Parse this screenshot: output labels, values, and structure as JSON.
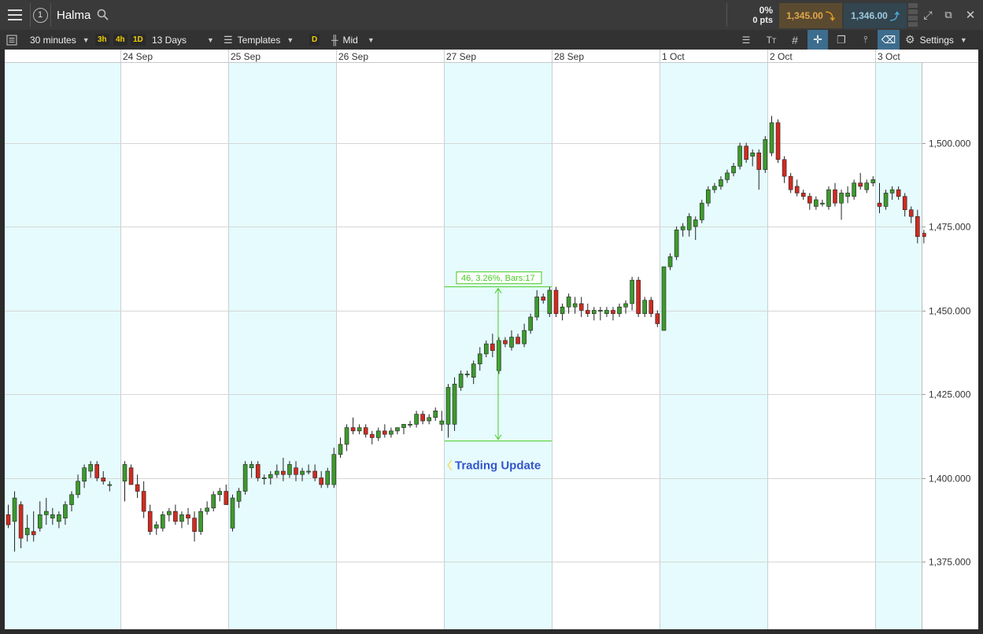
{
  "header": {
    "symbol": "Halma",
    "watchlist_number": "1",
    "change_pct": "0%",
    "change_pts": "0 pts",
    "sell_price": "1,345.00",
    "buy_price": "1,346.00"
  },
  "toolbar": {
    "interval": "30 minutes",
    "quick_intervals": [
      "3h",
      "4h",
      "1D"
    ],
    "range": "13 Days",
    "templates": "Templates",
    "price_type_badge": "D",
    "price_type": "Mid",
    "settings": "Settings"
  },
  "chart_data": {
    "type": "candlestick",
    "instrument": "Halma",
    "interval": "30 minutes",
    "x_labels": [
      "24 Sep",
      "25 Sep",
      "26 Sep",
      "27 Sep",
      "28 Sep",
      "1 Oct",
      "2 Oct",
      "3 Oct"
    ],
    "y_ticks": [
      "1,375.000",
      "1,400.000",
      "1,425.000",
      "1,450.000",
      "1,475.000",
      "1,500.000"
    ],
    "ylim": [
      1356.2,
      1522.5
    ],
    "grid": true,
    "up_color": "#3d9a2e",
    "down_color": "#d02b20",
    "day_shading_color": "#e6fbfd",
    "days": [
      {
        "label": "",
        "shaded": true,
        "candles": [
          [
            1389,
            1392,
            1385,
            1386
          ],
          [
            1387,
            1396,
            1378,
            1394
          ],
          [
            1392,
            1393,
            1379,
            1382
          ],
          [
            1383,
            1389,
            1381,
            1385
          ],
          [
            1384,
            1390,
            1381,
            1383
          ],
          [
            1385,
            1393,
            1384,
            1389
          ],
          [
            1389,
            1394,
            1386,
            1390
          ],
          [
            1388,
            1391,
            1386,
            1389
          ],
          [
            1387,
            1390,
            1385,
            1389
          ],
          [
            1388,
            1393,
            1386,
            1392
          ],
          [
            1392,
            1396,
            1390,
            1395
          ],
          [
            1395,
            1401,
            1394,
            1399
          ],
          [
            1399,
            1404,
            1397,
            1403
          ],
          [
            1402,
            1405,
            1400,
            1404
          ],
          [
            1404,
            1405,
            1399,
            1400
          ],
          [
            1400,
            1402,
            1398,
            1399
          ],
          [
            1398,
            1399,
            1396,
            1398
          ]
        ]
      },
      {
        "label": "24 Sep",
        "shaded": false,
        "candles": [
          [
            1399,
            1405,
            1393,
            1404
          ],
          [
            1403,
            1404,
            1398,
            1398
          ],
          [
            1398,
            1401,
            1394,
            1396
          ],
          [
            1396,
            1399,
            1388,
            1390
          ],
          [
            1390,
            1392,
            1383,
            1384
          ],
          [
            1385,
            1387,
            1383,
            1386
          ],
          [
            1385,
            1390,
            1384,
            1389
          ],
          [
            1389,
            1391,
            1387,
            1390
          ],
          [
            1390,
            1392,
            1386,
            1387
          ],
          [
            1387,
            1390,
            1385,
            1389
          ],
          [
            1389,
            1391,
            1386,
            1388
          ],
          [
            1388,
            1390,
            1381,
            1384
          ],
          [
            1384,
            1391,
            1383,
            1390
          ],
          [
            1390,
            1393,
            1389,
            1391
          ],
          [
            1391,
            1396,
            1390,
            1395
          ],
          [
            1395,
            1397,
            1393,
            1396
          ],
          [
            1396,
            1398,
            1392,
            1392
          ]
        ]
      },
      {
        "label": "25 Sep",
        "shaded": true,
        "candles": [
          [
            1385,
            1395,
            1384,
            1394
          ],
          [
            1393,
            1397,
            1391,
            1396
          ],
          [
            1396,
            1405,
            1395,
            1404
          ],
          [
            1403,
            1405,
            1400,
            1404
          ],
          [
            1404,
            1405,
            1399,
            1400
          ],
          [
            1400,
            1401,
            1398,
            1400
          ],
          [
            1400,
            1402,
            1398,
            1401
          ],
          [
            1401,
            1404,
            1400,
            1402
          ],
          [
            1402,
            1406,
            1399,
            1401
          ],
          [
            1401,
            1405,
            1400,
            1404
          ],
          [
            1403,
            1405,
            1399,
            1401
          ],
          [
            1401,
            1403,
            1399,
            1402
          ],
          [
            1402,
            1404,
            1401,
            1402
          ],
          [
            1402,
            1404,
            1399,
            1400
          ],
          [
            1400,
            1402,
            1397,
            1398
          ],
          [
            1398,
            1403,
            1397,
            1402
          ],
          [
            1398,
            1409,
            1397,
            1407
          ]
        ]
      },
      {
        "label": "26 Sep",
        "shaded": false,
        "candles": [
          [
            1407,
            1412,
            1406,
            1410
          ],
          [
            1410,
            1416,
            1408,
            1415
          ],
          [
            1415,
            1418,
            1413,
            1414
          ],
          [
            1414,
            1416,
            1413,
            1415
          ],
          [
            1415,
            1416,
            1412,
            1413
          ],
          [
            1413,
            1414,
            1410,
            1412
          ],
          [
            1412,
            1415,
            1411,
            1414
          ],
          [
            1414,
            1416,
            1412,
            1413
          ],
          [
            1413,
            1415,
            1412,
            1414
          ],
          [
            1414,
            1415,
            1413,
            1415
          ],
          [
            1415,
            1416,
            1413,
            1416
          ],
          [
            1416,
            1417,
            1415,
            1416
          ],
          [
            1416,
            1420,
            1415,
            1419
          ],
          [
            1419,
            1420,
            1416,
            1417
          ],
          [
            1417,
            1419,
            1416,
            1418
          ],
          [
            1418,
            1421,
            1417,
            1420
          ],
          [
            1416,
            1420,
            1414,
            1417
          ]
        ]
      },
      {
        "label": "27 Sep",
        "shaded": true,
        "candles": [
          [
            1416,
            1428,
            1412,
            1427
          ],
          [
            1416,
            1430,
            1414,
            1428
          ],
          [
            1427,
            1432,
            1426,
            1431
          ],
          [
            1431,
            1432,
            1430,
            1431
          ],
          [
            1430,
            1435,
            1428,
            1434
          ],
          [
            1434,
            1439,
            1432,
            1437
          ],
          [
            1437,
            1441,
            1436,
            1440
          ],
          [
            1440,
            1443,
            1436,
            1438
          ],
          [
            1432,
            1442,
            1431,
            1441
          ],
          [
            1441,
            1442,
            1439,
            1440
          ],
          [
            1439,
            1444,
            1438,
            1442
          ],
          [
            1442,
            1443,
            1440,
            1440
          ],
          [
            1440,
            1446,
            1439,
            1444
          ],
          [
            1444,
            1449,
            1443,
            1448
          ],
          [
            1448,
            1456,
            1447,
            1454
          ],
          [
            1454,
            1455,
            1452,
            1453
          ],
          [
            1449,
            1457,
            1448,
            1456
          ]
        ]
      },
      {
        "label": "28 Sep",
        "shaded": false,
        "candles": [
          [
            1456,
            1457,
            1448,
            1449
          ],
          [
            1449,
            1452,
            1447,
            1451
          ],
          [
            1451,
            1455,
            1449,
            1454
          ],
          [
            1451,
            1454,
            1449,
            1452
          ],
          [
            1452,
            1454,
            1448,
            1450
          ],
          [
            1450,
            1452,
            1448,
            1449
          ],
          [
            1449,
            1451,
            1447,
            1450
          ],
          [
            1450,
            1451,
            1447,
            1450
          ],
          [
            1449,
            1451,
            1448,
            1450
          ],
          [
            1450,
            1451,
            1447,
            1449
          ],
          [
            1449,
            1452,
            1448,
            1451
          ],
          [
            1451,
            1453,
            1449,
            1452
          ],
          [
            1452,
            1460,
            1450,
            1459
          ],
          [
            1459,
            1460,
            1448,
            1449
          ],
          [
            1449,
            1454,
            1448,
            1453
          ],
          [
            1453,
            1454,
            1448,
            1449
          ],
          [
            1449,
            1450,
            1445,
            1446
          ]
        ]
      },
      {
        "label": "1 Oct",
        "shaded": true,
        "candles": [
          [
            1444,
            1463,
            1444,
            1463
          ],
          [
            1463,
            1467,
            1462,
            1466
          ],
          [
            1466,
            1475,
            1465,
            1474
          ],
          [
            1474,
            1476,
            1472,
            1475
          ],
          [
            1474,
            1479,
            1472,
            1478
          ],
          [
            1475,
            1478,
            1471,
            1477
          ],
          [
            1477,
            1483,
            1476,
            1482
          ],
          [
            1482,
            1487,
            1481,
            1486
          ],
          [
            1486,
            1488,
            1485,
            1487
          ],
          [
            1487,
            1490,
            1486,
            1489
          ],
          [
            1489,
            1492,
            1488,
            1491
          ],
          [
            1491,
            1494,
            1490,
            1493
          ],
          [
            1493,
            1500,
            1492,
            1499
          ],
          [
            1499,
            1500,
            1494,
            1495
          ],
          [
            1496,
            1498,
            1493,
            1497
          ],
          [
            1497,
            1498,
            1486,
            1492
          ],
          [
            1492,
            1502,
            1491,
            1501
          ]
        ]
      },
      {
        "label": "2 Oct",
        "shaded": false,
        "candles": [
          [
            1497,
            1508,
            1496,
            1506
          ],
          [
            1506,
            1507,
            1494,
            1495
          ],
          [
            1495,
            1496,
            1488,
            1490
          ],
          [
            1490,
            1491,
            1485,
            1486
          ],
          [
            1487,
            1489,
            1484,
            1485
          ],
          [
            1485,
            1486,
            1483,
            1484
          ],
          [
            1484,
            1485,
            1480,
            1482
          ],
          [
            1481,
            1484,
            1480,
            1483
          ],
          [
            1482,
            1483,
            1481,
            1482
          ],
          [
            1481,
            1487,
            1480,
            1486
          ],
          [
            1486,
            1488,
            1481,
            1482
          ],
          [
            1482,
            1486,
            1477,
            1485
          ],
          [
            1484,
            1487,
            1482,
            1485
          ],
          [
            1484,
            1489,
            1483,
            1488
          ],
          [
            1488,
            1491,
            1486,
            1487
          ],
          [
            1486,
            1489,
            1485,
            1488
          ],
          [
            1488,
            1490,
            1487,
            1489
          ]
        ]
      },
      {
        "label": "3 Oct",
        "shaded": true,
        "candles": [
          [
            1482,
            1488,
            1479,
            1481
          ],
          [
            1481,
            1486,
            1480,
            1485
          ],
          [
            1485,
            1487,
            1483,
            1486
          ],
          [
            1486,
            1487,
            1483,
            1484
          ],
          [
            1484,
            1485,
            1478,
            1480
          ],
          [
            1480,
            1481,
            1476,
            1478
          ],
          [
            1478,
            1480,
            1470,
            1472
          ],
          [
            1473,
            1474,
            1470,
            1472
          ]
        ]
      }
    ],
    "measure": {
      "from_day": 4,
      "from_candle": 0,
      "to_day": 5,
      "to_candle": 0,
      "top_value": 1457,
      "bottom_value": 1411,
      "label": "46, 3.26%, Bars:17",
      "color": "#44cc22"
    },
    "annotation": {
      "text": "Trading Update",
      "day": 4,
      "value": 1404,
      "color": "#3355cc"
    }
  }
}
